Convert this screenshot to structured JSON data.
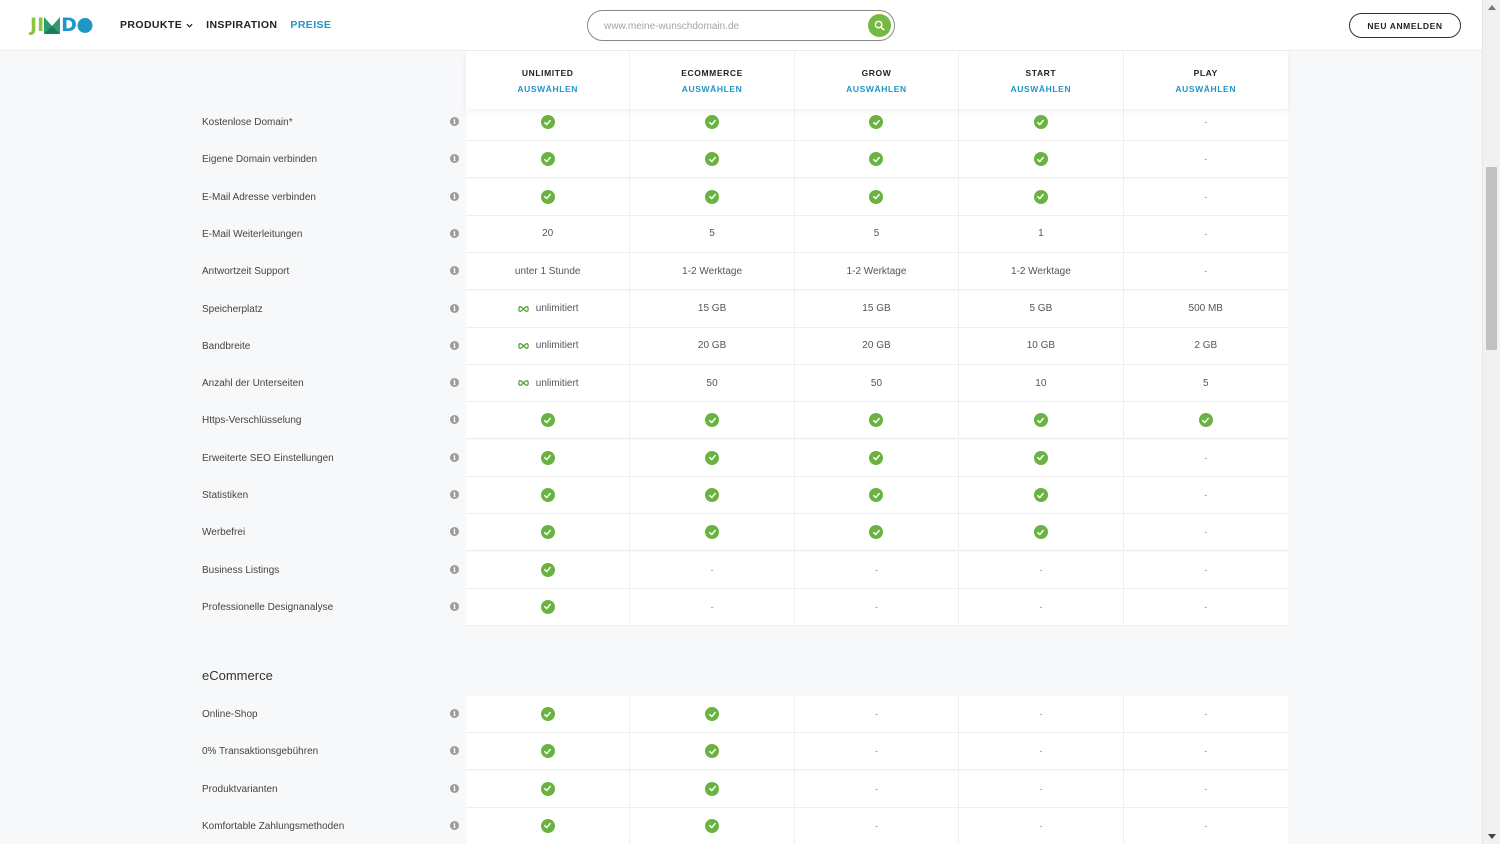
{
  "header": {
    "logo": "JIMDO",
    "nav": [
      {
        "label": "PRODUKTE",
        "has_dropdown": true,
        "active": false
      },
      {
        "label": "INSPIRATION",
        "has_dropdown": false,
        "active": false
      },
      {
        "label": "PREISE",
        "has_dropdown": false,
        "active": true
      }
    ],
    "search_placeholder": "www.meine-wunschdomain.de",
    "login_label": "NEU ANMELDEN"
  },
  "colors": {
    "accent_blue": "#1f96c4",
    "check_green": "#6ab343",
    "search_green": "#77b843"
  },
  "plans": [
    {
      "name": "UNLIMITED",
      "select": "AUSWÄHLEN"
    },
    {
      "name": "ECOMMERCE",
      "select": "AUSWÄHLEN"
    },
    {
      "name": "GROW",
      "select": "AUSWÄHLEN"
    },
    {
      "name": "START",
      "select": "AUSWÄHLEN"
    },
    {
      "name": "PLAY",
      "select": "AUSWÄHLEN"
    }
  ],
  "features": [
    {
      "label": "Kostenlose Domain*",
      "values": [
        "check",
        "check",
        "check",
        "check",
        "-"
      ]
    },
    {
      "label": "Eigene Domain verbinden",
      "values": [
        "check",
        "check",
        "check",
        "check",
        "-"
      ]
    },
    {
      "label": "E-Mail Adresse verbinden",
      "values": [
        "check",
        "check",
        "check",
        "check",
        "-"
      ]
    },
    {
      "label": "E-Mail Weiterleitungen",
      "values": [
        "20",
        "5",
        "5",
        "1",
        "-"
      ]
    },
    {
      "label": "Antwortzeit Support",
      "values": [
        "unter 1 Stunde",
        "1-2 Werktage",
        "1-2 Werktage",
        "1-2 Werktage",
        "-"
      ]
    },
    {
      "label": "Speicherplatz",
      "values": [
        "∞unlimitiert",
        "15 GB",
        "15 GB",
        "5 GB",
        "500 MB"
      ]
    },
    {
      "label": "Bandbreite",
      "values": [
        "∞unlimitiert",
        "20 GB",
        "20 GB",
        "10 GB",
        "2 GB"
      ]
    },
    {
      "label": "Anzahl der Unterseiten",
      "values": [
        "∞unlimitiert",
        "50",
        "50",
        "10",
        "5"
      ]
    },
    {
      "label": "Https-Verschlüsselung",
      "values": [
        "check",
        "check",
        "check",
        "check",
        "check"
      ]
    },
    {
      "label": "Erweiterte SEO Einstellungen",
      "values": [
        "check",
        "check",
        "check",
        "check",
        "-"
      ]
    },
    {
      "label": "Statistiken",
      "values": [
        "check",
        "check",
        "check",
        "check",
        "-"
      ]
    },
    {
      "label": "Werbefrei",
      "values": [
        "check",
        "check",
        "check",
        "check",
        "-"
      ]
    },
    {
      "label": "Business Listings",
      "values": [
        "check",
        "-",
        "-",
        "-",
        "-"
      ]
    },
    {
      "label": "Professionelle Designanalyse",
      "values": [
        "check",
        "-",
        "-",
        "-",
        "-"
      ]
    }
  ],
  "ecommerce": {
    "title": "eCommerce",
    "features": [
      {
        "label": "Online-Shop",
        "values": [
          "check",
          "check",
          "-",
          "-",
          "-"
        ]
      },
      {
        "label": "0% Transaktionsgebühren",
        "values": [
          "check",
          "check",
          "-",
          "-",
          "-"
        ]
      },
      {
        "label": "Produktvarianten",
        "values": [
          "check",
          "check",
          "-",
          "-",
          "-"
        ]
      },
      {
        "label": "Komfortable Zahlungsmethoden",
        "values": [
          "check",
          "check",
          "-",
          "-",
          "-"
        ]
      }
    ]
  }
}
